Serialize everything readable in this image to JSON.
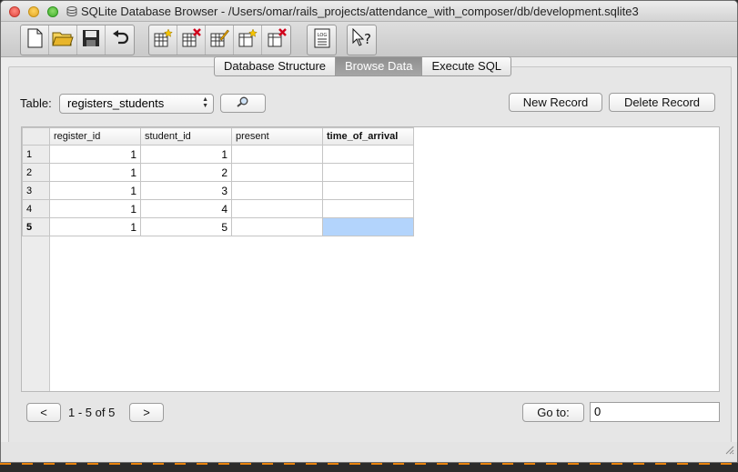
{
  "window": {
    "title": "SQLite Database Browser - /Users/omar/rails_projects/attendance_with_composer/db/development.sqlite3"
  },
  "toolbar": {
    "buttons": [
      "new-file-icon",
      "open-folder-icon",
      "save-disk-icon",
      "undo-icon",
      "create-table-icon",
      "delete-table-icon",
      "modify-table-icon",
      "create-index-icon",
      "delete-index-icon",
      "log-icon",
      "whats-this-icon"
    ]
  },
  "tabs": [
    {
      "label": "Database Structure",
      "active": false
    },
    {
      "label": "Browse Data",
      "active": true
    },
    {
      "label": "Execute SQL",
      "active": false
    }
  ],
  "browse": {
    "table_label": "Table:",
    "selected_table": "registers_students",
    "new_record_label": "New Record",
    "delete_record_label": "Delete Record"
  },
  "grid": {
    "columns": [
      "register_id",
      "student_id",
      "present",
      "time_of_arrival"
    ],
    "rows": [
      {
        "rownum": "1",
        "register_id": "1",
        "student_id": "1",
        "present": "",
        "time_of_arrival": ""
      },
      {
        "rownum": "2",
        "register_id": "1",
        "student_id": "2",
        "present": "",
        "time_of_arrival": ""
      },
      {
        "rownum": "3",
        "register_id": "1",
        "student_id": "3",
        "present": "",
        "time_of_arrival": ""
      },
      {
        "rownum": "4",
        "register_id": "1",
        "student_id": "4",
        "present": "",
        "time_of_arrival": ""
      },
      {
        "rownum": "5",
        "register_id": "1",
        "student_id": "5",
        "present": "",
        "time_of_arrival": ""
      }
    ]
  },
  "pager": {
    "prev_label": "<",
    "next_label": ">",
    "range_text": "1 - 5 of 5",
    "goto_label": "Go to:",
    "goto_value": "0"
  },
  "colors": {
    "selection": "#b3d4fc",
    "active_tab": "#9a9a9a",
    "background_dash": "#e8820c"
  }
}
